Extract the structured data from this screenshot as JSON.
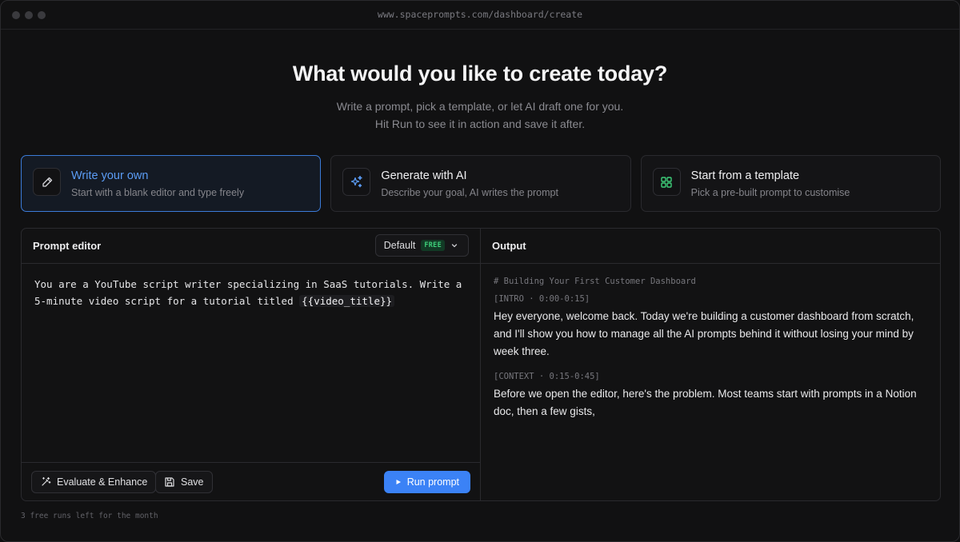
{
  "browser": {
    "url": "www.spaceprompts.com/dashboard/create"
  },
  "hero": {
    "title": "What would you like to create today?",
    "subtitle_line1": "Write a prompt, pick a template, or let AI draft one for you.",
    "subtitle_line2": "Hit Run to see it in action and save it after."
  },
  "modes": [
    {
      "title": "Write your own",
      "desc": "Start with a blank editor and type freely",
      "icon": "pencil-icon",
      "active": true
    },
    {
      "title": "Generate with AI",
      "desc": "Describe your goal, AI writes the prompt",
      "icon": "sparkle-icon",
      "active": false
    },
    {
      "title": "Start from a template",
      "desc": "Pick a pre-built prompt to customise",
      "icon": "grid-icon",
      "active": false
    }
  ],
  "editor": {
    "title": "Prompt editor",
    "model_label": "Default",
    "model_badge": "FREE",
    "text_line1": "You are a YouTube script writer specializing in SaaS tutorials. Write a",
    "text_line2": "5-minute video script for a tutorial titled ",
    "variable": "{{video_title}}",
    "evaluate_label": "Evaluate & Enhance",
    "save_label": "Save",
    "run_label": "Run prompt"
  },
  "output": {
    "title": "Output",
    "heading": "# Building Your First Customer Dashboard",
    "section1_tag": "[INTRO · 0:00-0:15]",
    "section1_text": "Hey everyone, welcome back. Today we're building a customer dashboard from scratch, and I'll show you how to manage all the AI prompts behind it without losing your mind by week three.",
    "section2_tag": "[CONTEXT · 0:15-0:45]",
    "section2_text": "Before we open the editor, here's the problem. Most teams start with prompts in a Notion doc, then a few gists,"
  },
  "footer": {
    "note": "3 free runs left for the month"
  },
  "colors": {
    "accent": "#3b82f6",
    "active_title": "#5b9cf5",
    "badge_green": "#3ecf7a"
  }
}
